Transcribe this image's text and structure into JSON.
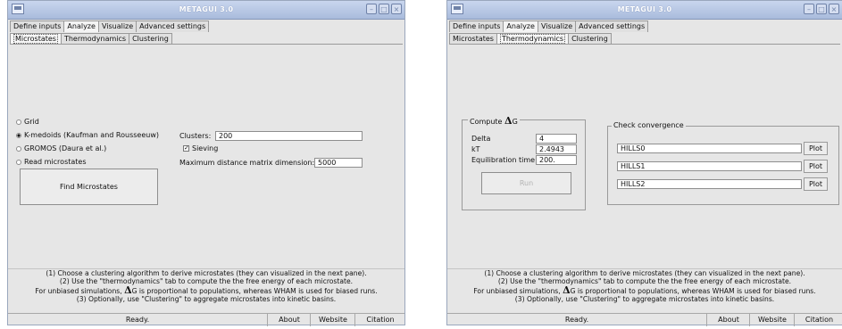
{
  "window_title": "METAGUI 3.0",
  "menu_tabs": [
    "Define inputs",
    "Analyze",
    "Visualize",
    "Advanced settings"
  ],
  "sub_tabs": [
    "Microstates",
    "Thermodynamics",
    "Clustering"
  ],
  "left": {
    "radios": [
      {
        "label": "Grid",
        "selected": false
      },
      {
        "label": "K-medoids (Kaufman and Rousseeuw)",
        "selected": true
      },
      {
        "label": "GROMOS (Daura et al.)",
        "selected": false
      },
      {
        "label": "Read microstates",
        "selected": false
      }
    ],
    "clusters_label": "Clusters:",
    "clusters_value": "200",
    "sieving_label": "Sieving",
    "sieving_checked": true,
    "maxdist_label": "Maximum distance matrix dimension:",
    "maxdist_value": "5000",
    "find_button": "Find Microstates"
  },
  "right": {
    "compute_label_prefix": "Compute",
    "compute_label_symbol": "Δ",
    "compute_label_suffix": "G",
    "delta_label": "Delta",
    "delta_value": "4",
    "kt_label": "kT",
    "kt_value": "2.4943",
    "equil_label": "Equilibration time",
    "equil_value": "200.",
    "run_button": "Run",
    "check_label": "Check convergence",
    "hills": [
      "HILLS0",
      "HILLS1",
      "HILLS2"
    ],
    "plot_button": "Plot"
  },
  "help": {
    "line1": "(1) Choose a clustering algorithm to derive microstates (they can visualized in the next pane).",
    "line2": "(2) Use the \"thermodynamics\" tab to compute the the free energy of each microstate.",
    "line3_prefix": "For unbiased simulations,",
    "line3_symbol": "Δ",
    "line3_suffix": "G is proportional to populations, whereas WHAM is used for biased runs.",
    "line4": "(3) Optionally, use \"Clustering\" to aggregate microstates into kinetic basins."
  },
  "statusbar": {
    "status": "Ready.",
    "about": "About",
    "website": "Website",
    "citation": "Citation"
  },
  "window_buttons": [
    "minimize-icon",
    "maximize-icon",
    "close-icon"
  ]
}
